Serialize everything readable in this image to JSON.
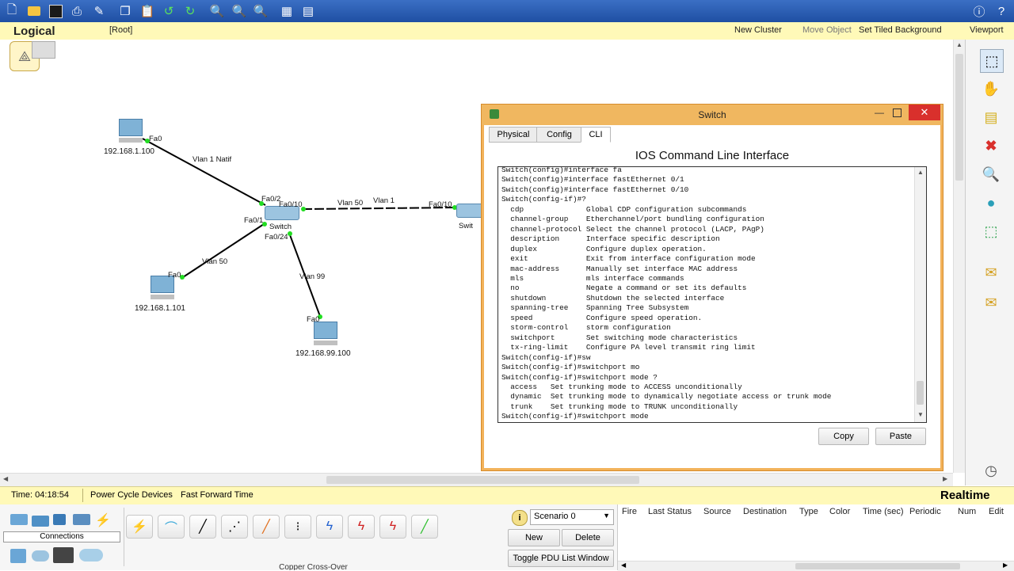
{
  "toolbar": {
    "icons": [
      "new-file-icon",
      "open-folder-icon",
      "save-icon",
      "print-icon",
      "activity-wizard-icon",
      "copy-icon",
      "paste-icon",
      "undo-icon",
      "redo-icon",
      "zoom-in-icon",
      "zoom-reset-icon",
      "zoom-out-icon",
      "palette-icon",
      "custom-device-icon",
      "info-icon",
      "help-icon"
    ]
  },
  "logical_bar": {
    "mode": "Logical",
    "root": "[Root]",
    "new_cluster": "New Cluster",
    "move_object": "Move Object",
    "set_tiled_background": "Set Tiled Background",
    "viewport": "Viewport"
  },
  "topology": {
    "pc1": {
      "ip": "192.168.1.100",
      "port": "Fa0"
    },
    "pc2": {
      "ip": "192.168.1.101",
      "port": "Fa0"
    },
    "pc3": {
      "ip": "192.168.99.100",
      "port": "Fa0"
    },
    "switch1": {
      "name": "Switch",
      "ports": [
        "Fa0/2",
        "Fa0/10",
        "Fa0/1",
        "Fa0/24"
      ]
    },
    "switch2": {
      "name": "Swit",
      "port": "Fa0/10"
    },
    "links": [
      "Vlan 1 Natif",
      "Vlan 50",
      "Vlan 1",
      "Vlan 50",
      "Vlan 99"
    ]
  },
  "cli_window": {
    "title": "Switch",
    "tabs": [
      "Physical",
      "Config",
      "CLI"
    ],
    "active_tab": "CLI",
    "heading": "IOS Command Line Interface",
    "lines": [
      "Switch(config)#interface fa",
      "Switch(config)#interface fastEthernet 0/1",
      "Switch(config)#interface fastEthernet 0/10",
      "Switch(config-if)#?",
      "  cdp              Global CDP configuration subcommands",
      "  channel-group    Etherchannel/port bundling configuration",
      "  channel-protocol Select the channel protocol (LACP, PAgP)",
      "  description      Interface specific description",
      "  duplex           Configure duplex operation.",
      "  exit             Exit from interface configuration mode",
      "  mac-address      Manually set interface MAC address",
      "  mls              mls interface commands",
      "  no               Negate a command or set its defaults",
      "  shutdown         Shutdown the selected interface",
      "  spanning-tree    Spanning Tree Subsystem",
      "  speed            Configure speed operation.",
      "  storm-control    storm configuration",
      "  switchport       Set switching mode characteristics",
      "  tx-ring-limit    Configure PA level transmit ring limit",
      "Switch(config-if)#sw",
      "Switch(config-if)#switchport mo",
      "Switch(config-if)#switchport mode ?",
      "  access   Set trunking mode to ACCESS unconditionally",
      "  dynamic  Set trunking mode to dynamically negotiate access or trunk mode",
      "  trunk    Set trunking mode to TRUNK unconditionally",
      "Switch(config-if)#switchport mode"
    ],
    "copy_label": "Copy",
    "paste_label": "Paste"
  },
  "timebar": {
    "time": "Time: 04:18:54",
    "power_cycle": "Power Cycle Devices",
    "fast_forward": "Fast Forward Time",
    "mode": "Realtime"
  },
  "bottom": {
    "connections_label": "Connections",
    "cable_label": "Copper Cross-Over",
    "scenario": "Scenario 0",
    "new_label": "New",
    "delete_label": "Delete",
    "toggle_pdu": "Toggle PDU List Window",
    "pdu_headers": [
      "Fire",
      "Last Status",
      "Source",
      "Destination",
      "Type",
      "Color",
      "Time (sec)",
      "Periodic",
      "Num",
      "Edit"
    ]
  },
  "colors": {
    "toolbar": "#2a5db0",
    "yellow_bar": "#fff9b8",
    "window_border": "#f0b760",
    "link_up": "#22dd22",
    "close_button": "#d9302c"
  }
}
